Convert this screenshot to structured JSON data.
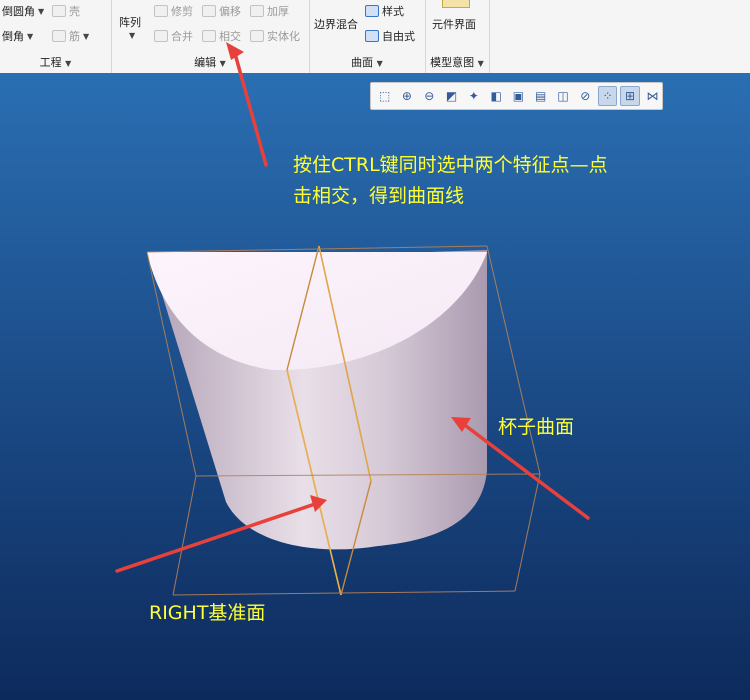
{
  "ribbon": {
    "engineering": {
      "title": "工程",
      "round_label": "倒圆角",
      "chamfer_label": "倒角",
      "shell_label": "壳",
      "rib_label": "筋"
    },
    "edit": {
      "title": "编辑",
      "pattern_label": "阵列",
      "trim_label": "修剪",
      "offset_label": "偏移",
      "thicken_label": "加厚",
      "merge_label": "合并",
      "intersect_label": "相交",
      "solidify_label": "实体化"
    },
    "surfaces": {
      "title": "曲面",
      "boundary_blend_label": "边界混合",
      "style_label": "样式",
      "freestyle_label": "自由式"
    },
    "model_intent": {
      "title": "模型意图",
      "component_interface_label": "元件界面"
    }
  },
  "view_toolbar": {
    "icons": [
      "refit-icon",
      "zoom-in-icon",
      "zoom-out-icon",
      "repaint-icon",
      "spin-center-icon",
      "display-style-icon",
      "saved-orientations-icon",
      "view-manager-icon",
      "plane-display-icon",
      "axis-display-icon",
      "point-display-icon",
      "csys-display-icon",
      "annotation-display-icon"
    ]
  },
  "annotations": {
    "instruction_line1": "按住CTRL键同时选中两个特征点—点",
    "instruction_line2": "击相交，得到曲面线",
    "cup_surface_label": "杯子曲面",
    "right_plane_label": "RIGHT基准面",
    "arrow_color": "#e8403a",
    "text_color": "#ffff33"
  },
  "colors": {
    "viewport_top": "#2a6fb3",
    "viewport_bottom": "#0d2a5c",
    "cup_fill": "#e8dde9",
    "plane_edge": "#c78a3c"
  }
}
